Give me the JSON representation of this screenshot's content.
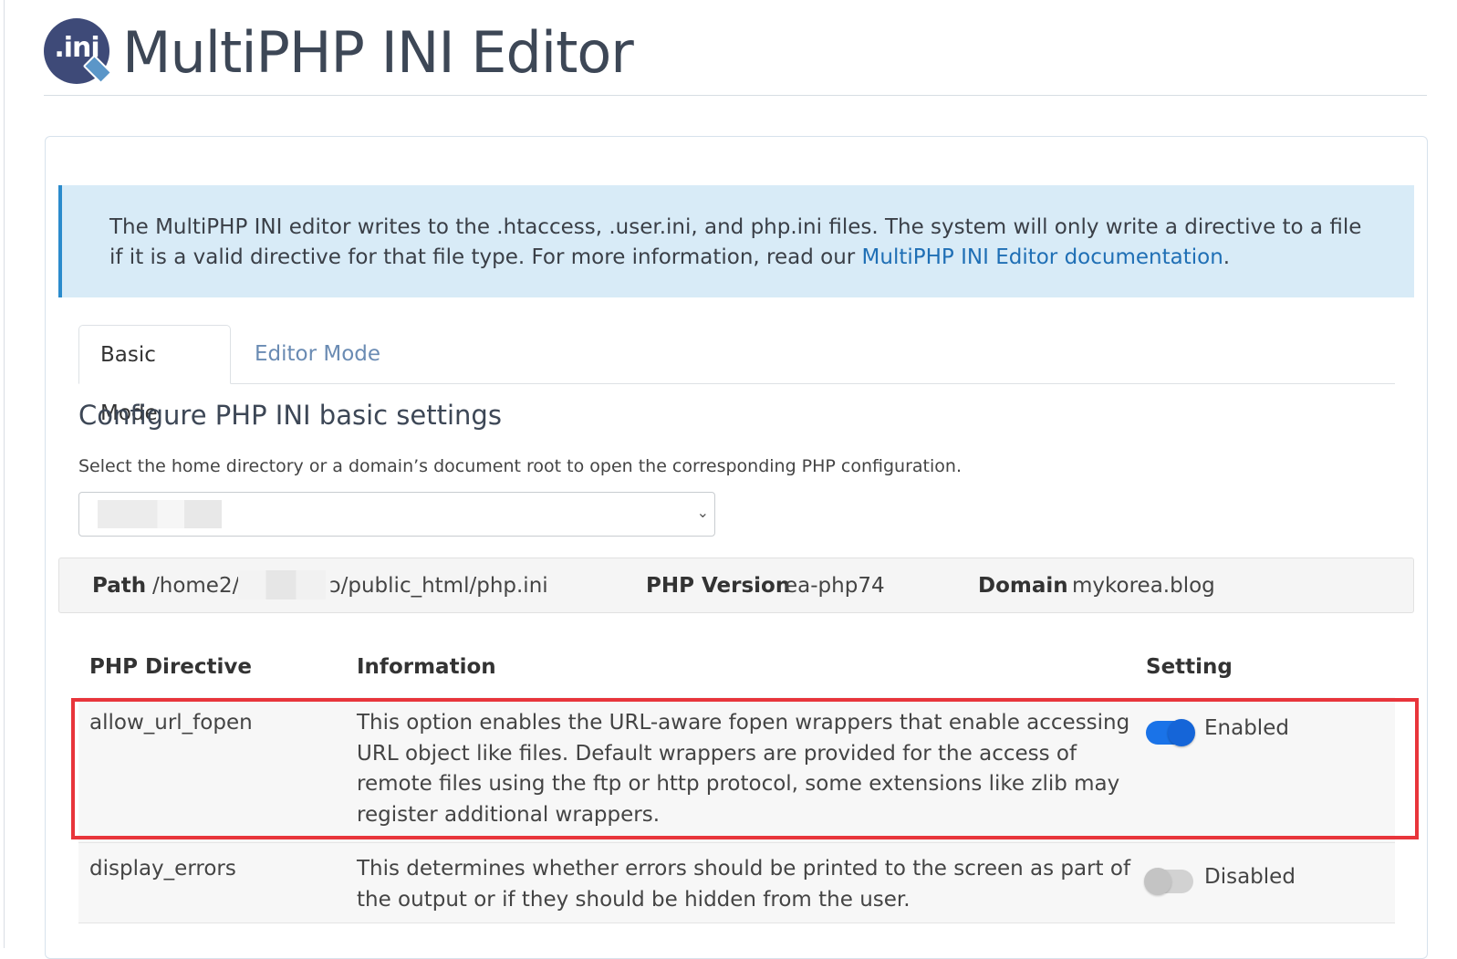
{
  "header": {
    "logo_text": ".ini",
    "title": "MultiPHP INI Editor"
  },
  "info_box": {
    "text": "The MultiPHP INI editor writes to the .htaccess, .user.ini, and php.ini files. The system will only write a directive to a file if it is a valid directive for that file type. For more information, read our ",
    "link_text": "MultiPHP INI Editor documentation",
    "suffix": "."
  },
  "tabs": [
    {
      "label": "Basic Mode",
      "active": true
    },
    {
      "label": "Editor Mode",
      "active": false
    }
  ],
  "section": {
    "heading": "Configure PHP INI basic settings",
    "help": "Select the home directory or a domain’s document root to open the corresponding PHP configuration."
  },
  "selector": {
    "value": ""
  },
  "info_bar": {
    "path_label": "Path",
    "path_prefix": "/home2/",
    "path_suffix": "ɔ/public_html/php.ini",
    "version_label": "PHP Version",
    "version_value": "ea-php74",
    "domain_label": "Domain",
    "domain_value": "mykorea.blog"
  },
  "table": {
    "headers": {
      "directive": "PHP Directive",
      "information": "Information",
      "setting": "Setting"
    },
    "rows": [
      {
        "directive": "allow_url_fopen",
        "information": "This option enables the URL-aware fopen wrappers that enable accessing URL object like files. Default wrappers are provided for the access of remote files using the ftp or http protocol, some extensions like zlib may register additional wrappers.",
        "setting": "Enabled",
        "enabled": true
      },
      {
        "directive": "display_errors",
        "information": "This determines whether errors should be printed to the screen as part of the output or if they should be hidden from the user.",
        "setting": "Disabled",
        "enabled": false
      }
    ]
  },
  "colors": {
    "accent": "#1a73e8",
    "highlight": "#e8353b",
    "info_bg": "#d8ebf7",
    "link": "#1f6fb5"
  }
}
